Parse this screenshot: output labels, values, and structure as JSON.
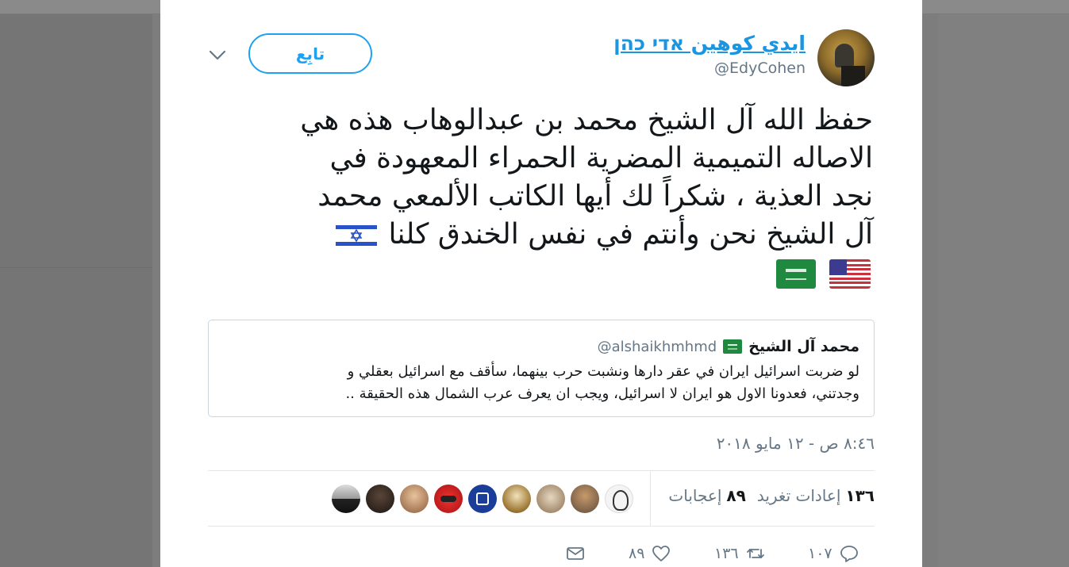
{
  "tweet": {
    "display_name": "ايدي كوهين אדי כהן",
    "handle": "@EdyCohen",
    "follow_label": "تابِع",
    "text_lines": [
      "حفظ الله آل الشيخ محمد بن عبدالوهاب هذه هي",
      "الاصاله التميمية المضرية الحمراء المعهودة في",
      "نجد العذية ، شكراً لك أيها الكاتب الألمعي محمد",
      "آل الشيخ نحن وأنتم في نفس الخندق كلنا"
    ],
    "flags": [
      "israel-flag",
      "usa-flag",
      "saudi-flag"
    ],
    "timestamp": "٨:٤٦ ص - ١٢ مايو ٢٠١٨"
  },
  "quote": {
    "name": "محمد آل الشيخ",
    "handle": "@alshaikhmhmd",
    "text_line1": "لو ضربت اسرائيل ايران في عقر دارها ونشبت حرب بينهما، سأقف مع اسرائيل بعقلي و",
    "text_line2": "وجدتني، فعدونا الاول هو ايران لا اسرائيل، ويجب ان يعرف عرب الشمال هذه الحقيقة .."
  },
  "stats": {
    "retweets_count": "١٣٦",
    "retweets_label": "إعادات تغريد",
    "likes_count": "٨٩",
    "likes_label": "إعجابات"
  },
  "actions": {
    "reply_count": "١٠٧",
    "retweet_count": "١٣٦",
    "like_count": "٨٩"
  },
  "colors": {
    "accent": "#1da1f2",
    "link": "#1b95e0",
    "muted": "#657786",
    "text": "#14171a",
    "border": "#e1e8ed"
  }
}
